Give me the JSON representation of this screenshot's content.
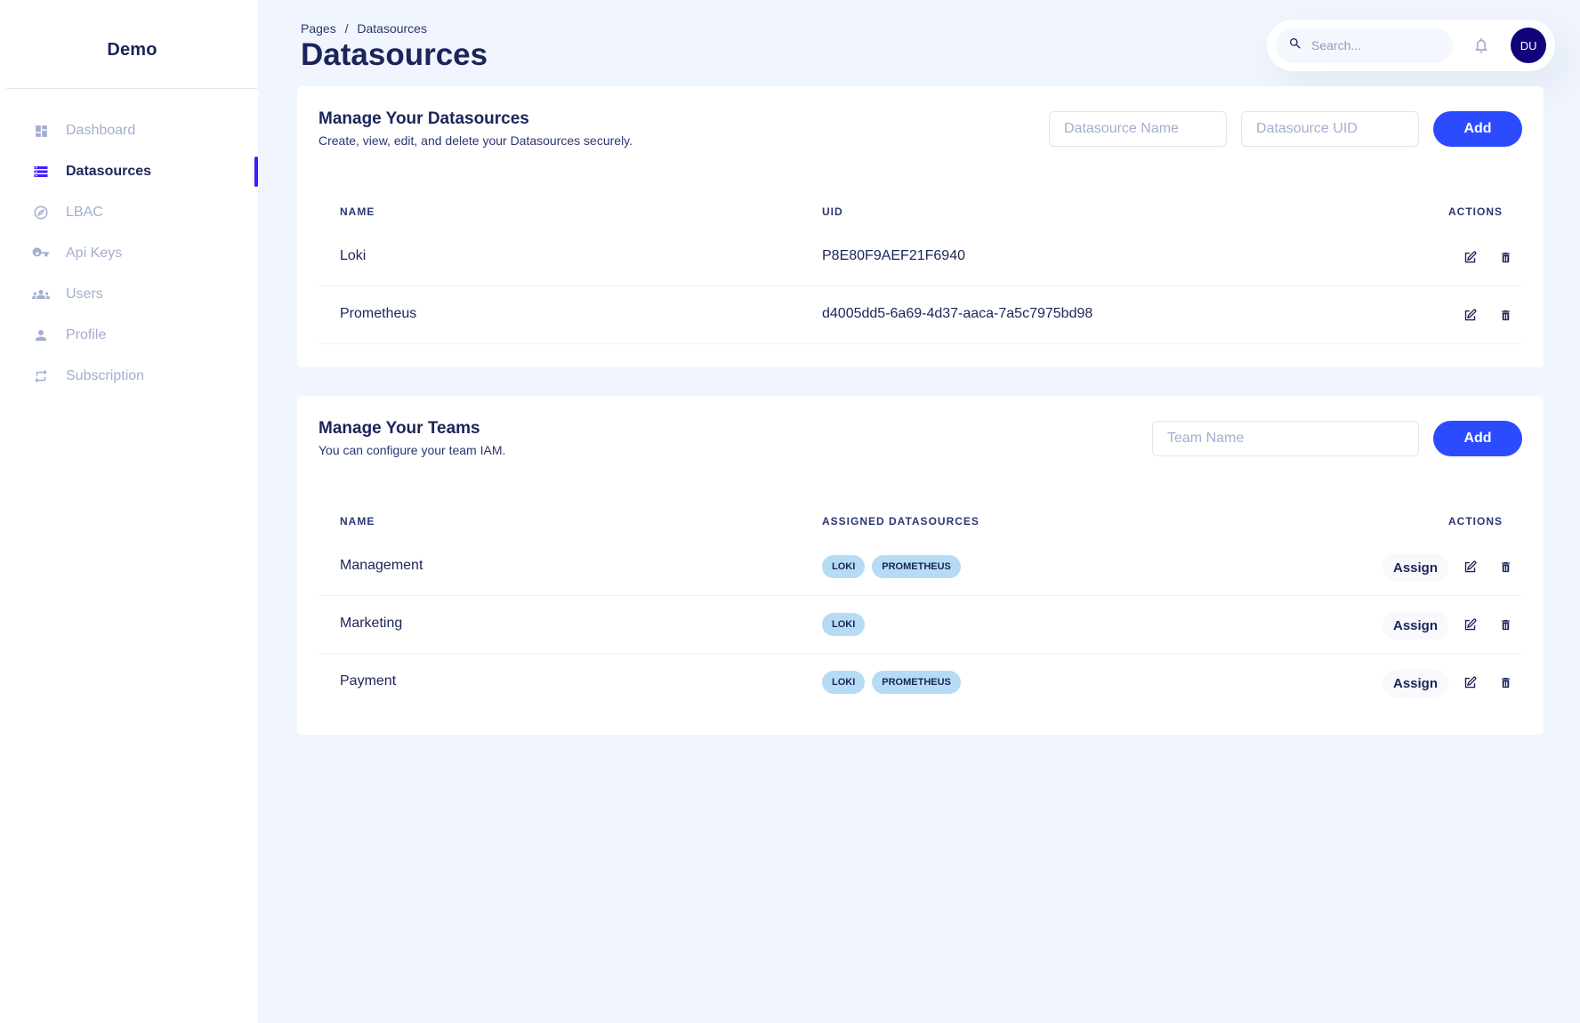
{
  "sidebar": {
    "brand": "Demo",
    "items": [
      {
        "label": "Dashboard",
        "icon": "dashboard-icon"
      },
      {
        "label": "Datasources",
        "icon": "list-icon",
        "active": true
      },
      {
        "label": "LBAC",
        "icon": "compass-icon"
      },
      {
        "label": "Api Keys",
        "icon": "key-icon"
      },
      {
        "label": "Users",
        "icon": "users-icon"
      },
      {
        "label": "Profile",
        "icon": "person-icon"
      },
      {
        "label": "Subscription",
        "icon": "repeat-icon"
      }
    ],
    "active_color": "#4318ff"
  },
  "header": {
    "breadcrumb": [
      "Pages",
      "/",
      "Datasources"
    ],
    "title": "Datasources",
    "search_placeholder": "Search...",
    "avatar_initials": "DU"
  },
  "datasources": {
    "title": "Manage Your Datasources",
    "subtitle": "Create, view, edit, and delete your Datasources securely.",
    "name_placeholder": "Datasource Name",
    "uid_placeholder": "Datasource UID",
    "add_label": "Add",
    "columns": [
      "NAME",
      "UID",
      "ACTIONS"
    ],
    "rows": [
      {
        "name": "Loki",
        "uid": "P8E80F9AEF21F6940"
      },
      {
        "name": "Prometheus",
        "uid": "d4005dd5-6a69-4d37-aaca-7a5c7975bd98"
      }
    ]
  },
  "teams": {
    "title": "Manage Your Teams",
    "subtitle": "You can configure your team IAM.",
    "name_placeholder": "Team Name",
    "add_label": "Add",
    "assign_label": "Assign",
    "columns": [
      "NAME",
      "ASSIGNED DATASOURCES",
      "ACTIONS"
    ],
    "rows": [
      {
        "name": "Management",
        "datasources": [
          "LOKI",
          "PROMETHEUS"
        ]
      },
      {
        "name": "Marketing",
        "datasources": [
          "LOKI"
        ]
      },
      {
        "name": "Payment",
        "datasources": [
          "LOKI",
          "PROMETHEUS"
        ]
      }
    ]
  },
  "colors": {
    "primary": "#2c4bff",
    "badge": "#b6dcf5",
    "text": "#1b2559"
  }
}
